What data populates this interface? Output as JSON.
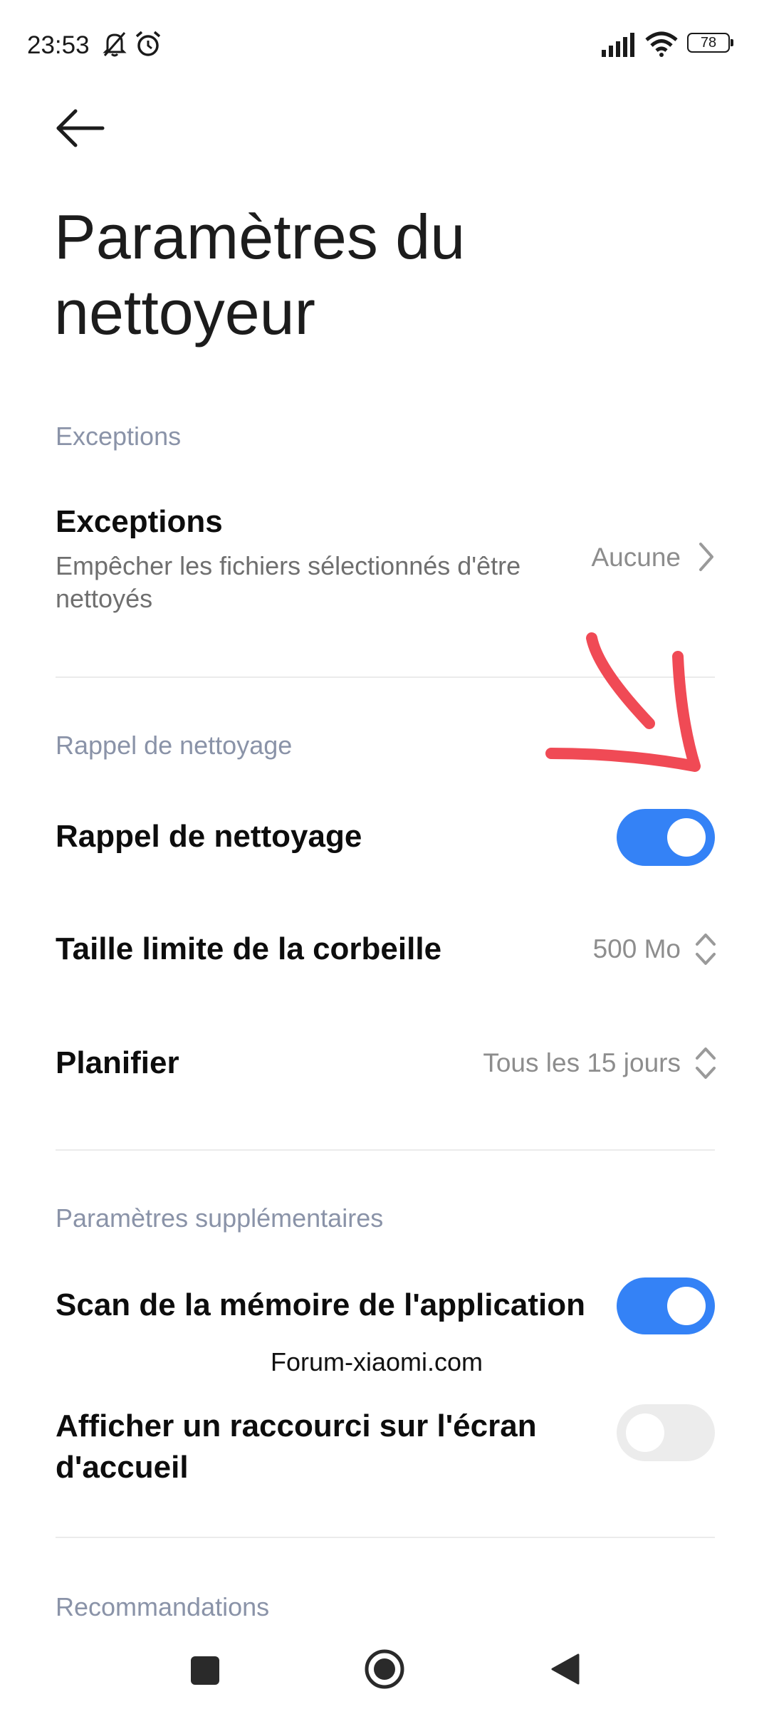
{
  "status_bar": {
    "time": "23:53",
    "battery": "78",
    "icons": [
      "bell-off-icon",
      "alarm-icon",
      "signal-icon",
      "wifi-icon",
      "battery-icon"
    ]
  },
  "header": {
    "back_icon": "arrow-left-icon",
    "title": "Paramètres du nettoyeur"
  },
  "sections": {
    "exceptions": {
      "header": "Exceptions",
      "item": {
        "title": "Exceptions",
        "subtitle": "Empêcher les fichiers sélectionnés d'être nettoyés",
        "value": "Aucune",
        "icon": "chevron-right-icon"
      }
    },
    "reminder": {
      "header": "Rappel de nettoyage",
      "toggle_item": {
        "title": "Rappel de nettoyage",
        "checked": true
      },
      "trash_item": {
        "title": "Taille limite de la corbeille",
        "value": "500 Mo",
        "icon": "up-down-chevron-icon"
      },
      "schedule_item": {
        "title": "Planifier",
        "value": "Tous les 15 jours",
        "icon": "up-down-chevron-icon"
      }
    },
    "extra": {
      "header": "Paramètres supplémentaires",
      "scan_item": {
        "title": "Scan de la mémoire de l'application",
        "checked": true
      },
      "shortcut_item": {
        "title": "Afficher un raccourci sur l'écran d'accueil",
        "checked": false
      }
    },
    "recommendations": {
      "header": "Recommandations"
    }
  },
  "watermark": "Forum-xiaomi.com",
  "colors": {
    "accent": "#3482f6",
    "section_header": "#8a93a8",
    "annotation": "#f04a55"
  },
  "nav_bar": {
    "icons": [
      "recents-square-icon",
      "home-circle-icon",
      "back-triangle-icon"
    ]
  }
}
